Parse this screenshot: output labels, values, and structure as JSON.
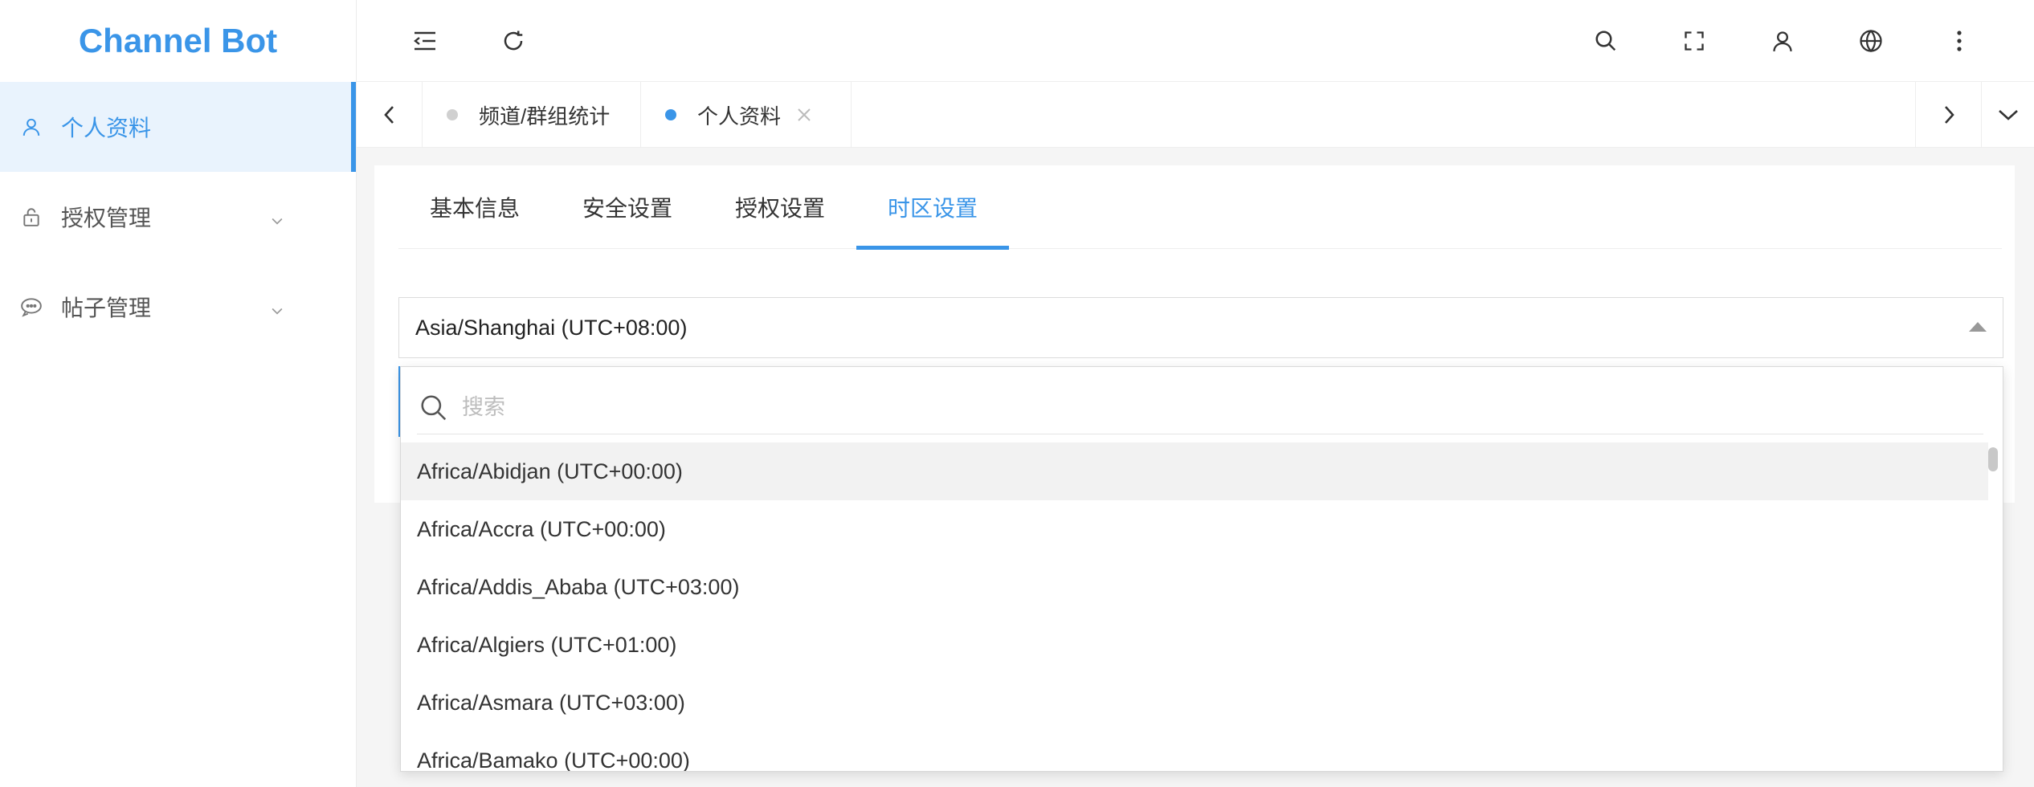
{
  "app": {
    "title": "Channel Bot"
  },
  "sidebar": {
    "items": [
      {
        "label": "个人资料",
        "icon": "user-icon",
        "active": true
      },
      {
        "label": "授权管理",
        "icon": "lock-icon",
        "expandable": true
      },
      {
        "label": "帖子管理",
        "icon": "chat-bubble-icon",
        "expandable": true
      }
    ]
  },
  "header": {
    "icons": [
      "menu-fold-icon",
      "refresh-icon",
      "search-icon",
      "fullscreen-icon",
      "user-icon",
      "globe-icon",
      "more-vertical-icon"
    ]
  },
  "tabs": {
    "items": [
      {
        "label": "频道/群组统计",
        "active": false
      },
      {
        "label": "个人资料",
        "active": true,
        "closable": true
      }
    ]
  },
  "subtabs": {
    "items": [
      {
        "label": "基本信息"
      },
      {
        "label": "安全设置"
      },
      {
        "label": "授权设置"
      },
      {
        "label": "时区设置",
        "active": true
      }
    ]
  },
  "timezone": {
    "selected": "Asia/Shanghai (UTC+08:00)",
    "search_placeholder": "搜索",
    "options": [
      "Africa/Abidjan (UTC+00:00)",
      "Africa/Accra (UTC+00:00)",
      "Africa/Addis_Ababa (UTC+03:00)",
      "Africa/Algiers (UTC+01:00)",
      "Africa/Asmara (UTC+03:00)",
      "Africa/Bamako (UTC+00:00)"
    ]
  },
  "colors": {
    "accent": "#3a95e8",
    "hover": "#f2f2f2"
  }
}
